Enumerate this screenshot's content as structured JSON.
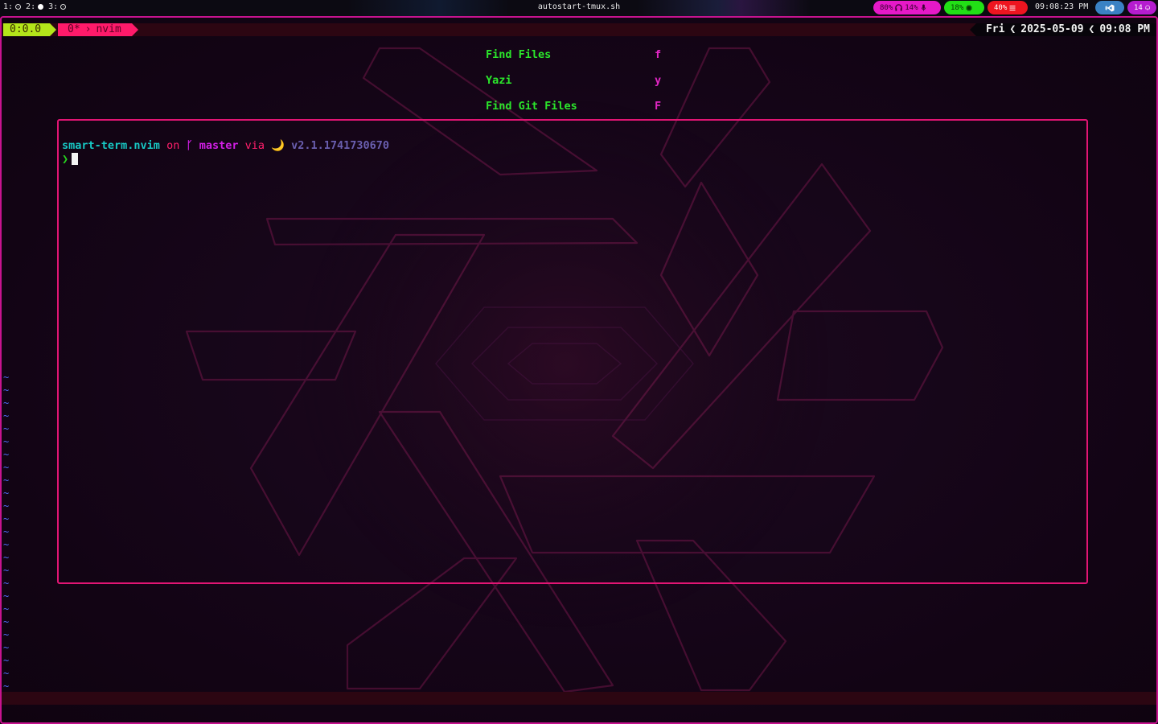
{
  "topbar": {
    "workspaces": [
      {
        "label": "1:",
        "state": "ring"
      },
      {
        "label": "2:",
        "state": "filled"
      },
      {
        "label": "3:",
        "state": "ring"
      }
    ],
    "window_title": "autostart-tmux.sh",
    "audio": {
      "volume": "80%",
      "headphone_icon": "headphones-icon",
      "mic": "14%",
      "mic_icon": "microphone-icon"
    },
    "cpu": {
      "value": "18%",
      "icon": "cpu-chip-icon"
    },
    "memory": {
      "value": "40%",
      "icon": "memory-icon"
    },
    "clock": "09:08:23 PM",
    "tray_icon": "vscode-icon",
    "notifications": {
      "count": "14",
      "icon": "bell-icon"
    },
    "colors": {
      "audio": "#e619c8",
      "cpu": "#22e016",
      "memory": "#ee1520",
      "tray": "#3a82c4",
      "notifications": "#b51ccf"
    }
  },
  "tmux": {
    "session": "0:0.0",
    "window_index": "0*",
    "window_name": "nvim",
    "day": "Fri",
    "date": "2025-05-09",
    "time": "09:08 PM",
    "colors": {
      "session": "#b3e51a",
      "window": "#ff1a6a"
    }
  },
  "dashboard": {
    "items": [
      {
        "label": "Find Files",
        "key": "f"
      },
      {
        "label": "Yazi",
        "key": "y"
      },
      {
        "label": "Find Git Files",
        "key": "F"
      }
    ]
  },
  "floating_terminal": {
    "directory": "smart-term.nvim",
    "on": "on",
    "branch": "master",
    "via": "via",
    "moon": "🌙",
    "version": "v2.1.1741730670",
    "prompt_char": "❯"
  },
  "vim": {
    "empty_line_marker": "~",
    "empty_line_count": 26
  }
}
